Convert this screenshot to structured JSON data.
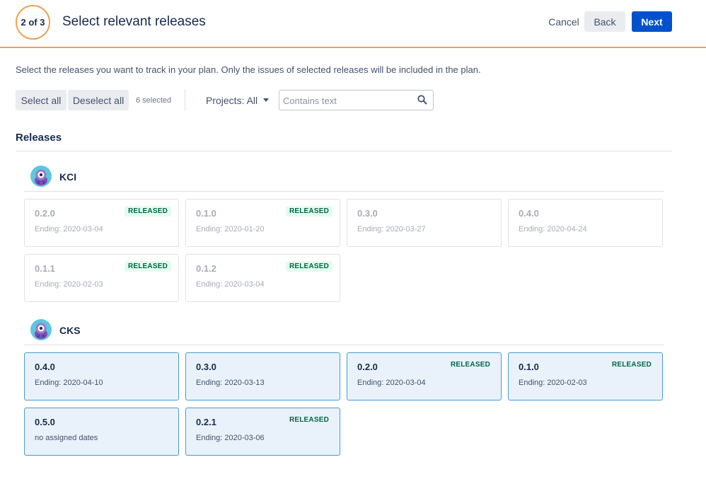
{
  "header": {
    "step": "2 of 3",
    "title": "Select relevant releases",
    "cancel_label": "Cancel",
    "back_label": "Back",
    "next_label": "Next"
  },
  "instructions": "Select the releases you want to track in your plan. Only the issues of selected releases will be included in the plan.",
  "toolbar": {
    "select_all_label": "Select all",
    "deselect_all_label": "Deselect all",
    "selected_count": "6 selected",
    "projects_filter": "Projects: All",
    "search_placeholder": "Contains text",
    "search_value": ""
  },
  "releases_heading": "Releases",
  "colors": {
    "accent_orange": "#f0a050",
    "primary_blue": "#0052cc",
    "selected_bg": "#e9f2fa",
    "released_green": "#006644"
  },
  "projects": [
    {
      "name": "KCI",
      "icon": "monster-avatar-icon",
      "releases": [
        {
          "version": "0.2.0",
          "ending": "Ending: 2020-03-04",
          "badge": "RELEASED",
          "selected": false
        },
        {
          "version": "0.1.0",
          "ending": "Ending: 2020-01-20",
          "badge": "RELEASED",
          "selected": false
        },
        {
          "version": "0.3.0",
          "ending": "Ending: 2020-03-27",
          "badge": "",
          "selected": false
        },
        {
          "version": "0.4.0",
          "ending": "Ending: 2020-04-24",
          "badge": "",
          "selected": false
        },
        {
          "version": "0.1.1",
          "ending": "Ending: 2020-02-03",
          "badge": "RELEASED",
          "selected": false
        },
        {
          "version": "0.1.2",
          "ending": "Ending: 2020-03-04",
          "badge": "RELEASED",
          "selected": false
        }
      ]
    },
    {
      "name": "CKS",
      "icon": "monster-avatar-icon",
      "releases": [
        {
          "version": "0.4.0",
          "ending": "Ending: 2020-04-10",
          "badge": "",
          "selected": true
        },
        {
          "version": "0.3.0",
          "ending": "Ending: 2020-03-13",
          "badge": "",
          "selected": true
        },
        {
          "version": "0.2.0",
          "ending": "Ending: 2020-03-04",
          "badge": "RELEASED",
          "selected": true
        },
        {
          "version": "0.1.0",
          "ending": "Ending: 2020-02-03",
          "badge": "RELEASED",
          "selected": true
        },
        {
          "version": "0.5.0",
          "ending": "no assigned dates",
          "badge": "",
          "selected": true
        },
        {
          "version": "0.2.1",
          "ending": "Ending: 2020-03-06",
          "badge": "RELEASED",
          "selected": true
        }
      ]
    }
  ]
}
